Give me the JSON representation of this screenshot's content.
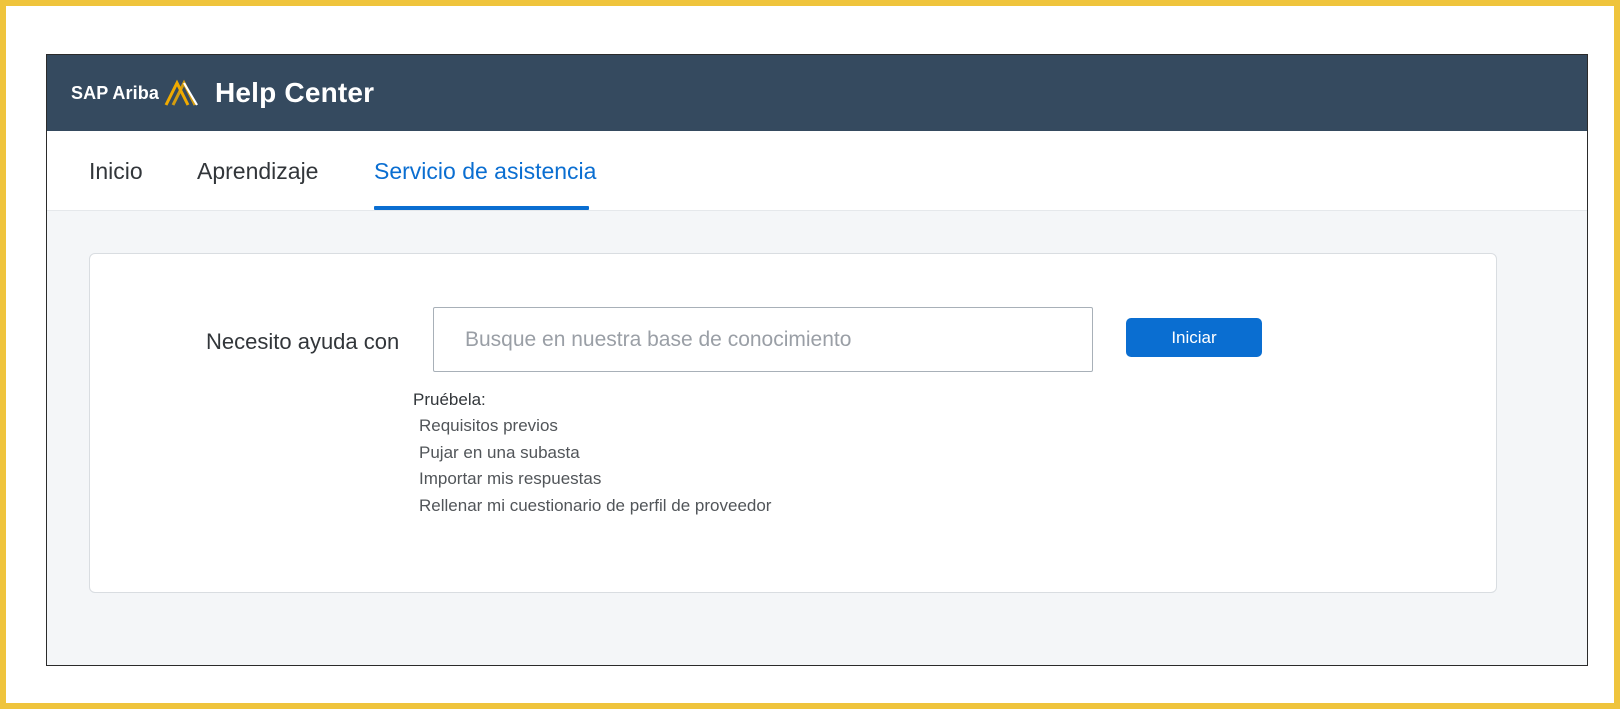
{
  "header": {
    "brand_company": "SAP Ariba",
    "brand_product": "Help Center",
    "background_color": "#354a5f",
    "logo_icon": "ariba-chevron-logo"
  },
  "nav": {
    "tabs": [
      {
        "label": "Inicio",
        "active": false
      },
      {
        "label": "Aprendizaje",
        "active": false
      },
      {
        "label": "Servicio de asistencia",
        "active": true
      }
    ],
    "active_color": "#0a6ed1"
  },
  "search": {
    "label": "Necesito ayuda con",
    "value": "",
    "placeholder": "Busque en nuestra base de conocimiento",
    "button_label": "Iniciar",
    "button_color": "#0a6ed1"
  },
  "suggestions": {
    "label": "Pruébela:",
    "items": [
      "Requisitos previos",
      "Pujar en una subasta",
      "Importar mis respuestas",
      "Rellenar mi cuestionario de perfil de proveedor"
    ]
  },
  "frame": {
    "border_color": "#efc43c"
  }
}
